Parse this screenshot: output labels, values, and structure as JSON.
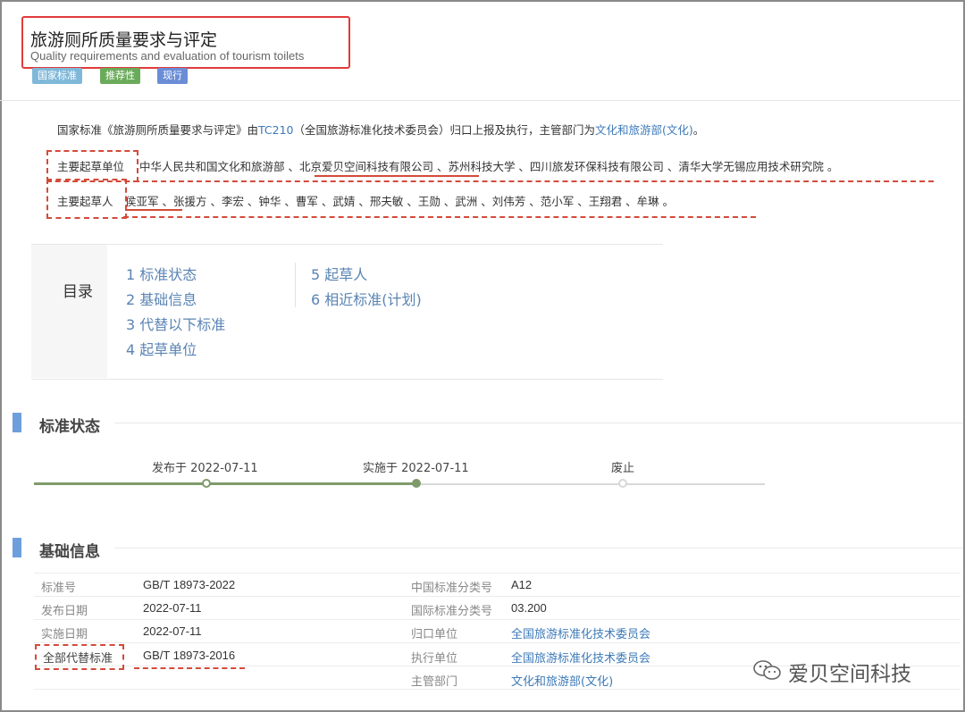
{
  "title": {
    "cn": "旅游厕所质量要求与评定",
    "en": "Quality requirements and evaluation of tourism toilets"
  },
  "badges": [
    "国家标准",
    "推荐性",
    "现行"
  ],
  "description": {
    "prefix": "国家标准《旅游厕所质量要求与评定》由",
    "tc": "TC210",
    "middle": "（全国旅游标准化技术委员会）归口上报及执行，主管部门为",
    "dept": "文化和旅游部(文化)",
    "suffix": "。"
  },
  "drafting_units": {
    "label": "主要起草单位",
    "value": "中华人民共和国文化和旅游部 、北京爱贝空间科技有限公司 、苏州科技大学 、四川旅发环保科技有限公司 、清华大学无锡应用技术研究院 。"
  },
  "drafters": {
    "label": "主要起草人",
    "value": "侯亚军 、张援方 、李宏 、钟华 、曹军 、武婧 、邢夫敏 、王勋 、武洲 、刘伟芳 、范小军 、王翔君 、牟琳 。"
  },
  "toc": {
    "title": "目录",
    "items": [
      "1 标准状态",
      "2 基础信息",
      "3 代替以下标准",
      "4 起草单位",
      "5 起草人",
      "6 相近标准(计划)"
    ]
  },
  "status_section": {
    "title": "标准状态",
    "published": "发布于 2022-07-11",
    "implemented": "实施于 2022-07-11",
    "abolished": "废止"
  },
  "basic_section": {
    "title": "基础信息",
    "left": [
      {
        "label": "标准号",
        "value": "GB/T 18973-2022"
      },
      {
        "label": "发布日期",
        "value": "2022-07-11"
      },
      {
        "label": "实施日期",
        "value": "2022-07-11"
      },
      {
        "label": "全部代替标准",
        "value": "GB/T 18973-2016"
      }
    ],
    "right": [
      {
        "label": "中国标准分类号",
        "value": "A12"
      },
      {
        "label": "国际标准分类号",
        "value": "03.200"
      },
      {
        "label": "归口单位",
        "value": "全国旅游标准化技术委员会"
      },
      {
        "label": "执行单位",
        "value": "全国旅游标准化技术委员会"
      },
      {
        "label": "主管部门",
        "value": "文化和旅游部(文化)"
      }
    ]
  },
  "watermark": "爱贝空间科技",
  "colors": {
    "accent_red": "#e03b3b",
    "link": "#3d7ab8",
    "badge_national": "#7fb8d9",
    "badge_recommended": "#6aab5a",
    "badge_current": "#6a8dd6",
    "section_bar": "#6d9fdd",
    "timeline": "#7f9a6a"
  }
}
